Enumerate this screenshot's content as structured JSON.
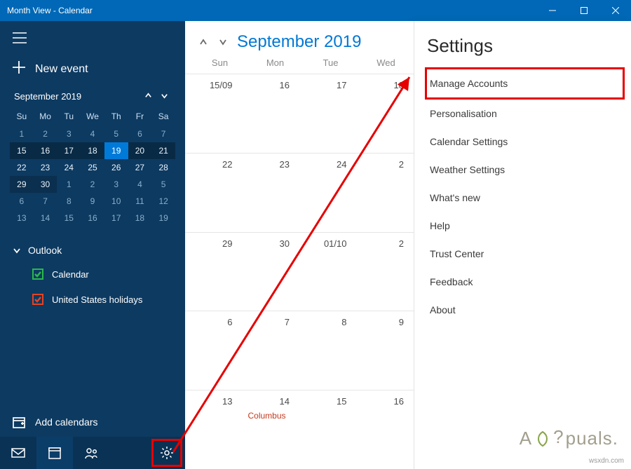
{
  "window": {
    "title": "Month View - Calendar"
  },
  "sidebar": {
    "new_event": "New event",
    "mini_calendar": {
      "title": "September 2019",
      "dows": [
        "Su",
        "Mo",
        "Tu",
        "We",
        "Th",
        "Fr",
        "Sa"
      ],
      "rows": [
        [
          {
            "n": "1",
            "cls": "out"
          },
          {
            "n": "2",
            "cls": "out"
          },
          {
            "n": "3",
            "cls": "out"
          },
          {
            "n": "4",
            "cls": "out"
          },
          {
            "n": "5",
            "cls": "out"
          },
          {
            "n": "6",
            "cls": "out"
          },
          {
            "n": "7",
            "cls": "out"
          }
        ],
        [
          {
            "n": "15",
            "cls": "current-week"
          },
          {
            "n": "16",
            "cls": "current-week"
          },
          {
            "n": "17",
            "cls": "current-week"
          },
          {
            "n": "18",
            "cls": "current-week"
          },
          {
            "n": "19",
            "cls": "today"
          },
          {
            "n": "20",
            "cls": "current-week"
          },
          {
            "n": "21",
            "cls": "current-week"
          }
        ],
        [
          {
            "n": "22",
            "cls": ""
          },
          {
            "n": "23",
            "cls": ""
          },
          {
            "n": "24",
            "cls": ""
          },
          {
            "n": "25",
            "cls": ""
          },
          {
            "n": "26",
            "cls": ""
          },
          {
            "n": "27",
            "cls": ""
          },
          {
            "n": "28",
            "cls": ""
          }
        ],
        [
          {
            "n": "29",
            "cls": "prev-cur"
          },
          {
            "n": "30",
            "cls": "prev-cur"
          },
          {
            "n": "1",
            "cls": "out"
          },
          {
            "n": "2",
            "cls": "out"
          },
          {
            "n": "3",
            "cls": "out"
          },
          {
            "n": "4",
            "cls": "out"
          },
          {
            "n": "5",
            "cls": "out"
          }
        ],
        [
          {
            "n": "6",
            "cls": "out"
          },
          {
            "n": "7",
            "cls": "out"
          },
          {
            "n": "8",
            "cls": "out"
          },
          {
            "n": "9",
            "cls": "out"
          },
          {
            "n": "10",
            "cls": "out"
          },
          {
            "n": "11",
            "cls": "out"
          },
          {
            "n": "12",
            "cls": "out"
          }
        ],
        [
          {
            "n": "13",
            "cls": "out"
          },
          {
            "n": "14",
            "cls": "out"
          },
          {
            "n": "15",
            "cls": "out"
          },
          {
            "n": "16",
            "cls": "out"
          },
          {
            "n": "17",
            "cls": "out"
          },
          {
            "n": "18",
            "cls": "out"
          },
          {
            "n": "19",
            "cls": "out"
          }
        ]
      ]
    },
    "accounts": [
      {
        "name": "Outlook",
        "calendars": [
          {
            "label": "Calendar",
            "color": "green"
          },
          {
            "label": "United States holidays",
            "color": "red"
          }
        ]
      }
    ],
    "add_calendars": "Add calendars"
  },
  "calendar": {
    "title": "September 2019",
    "dows": [
      "Sun",
      "Mon",
      "Tue",
      "Wed"
    ],
    "weeks": [
      [
        {
          "label": "15/09"
        },
        {
          "label": "16"
        },
        {
          "label": "17"
        },
        {
          "label": "18"
        }
      ],
      [
        {
          "label": "22"
        },
        {
          "label": "23"
        },
        {
          "label": "24"
        },
        {
          "label": "2"
        }
      ],
      [
        {
          "label": "29"
        },
        {
          "label": "30"
        },
        {
          "label": "01/10"
        },
        {
          "label": "2"
        }
      ],
      [
        {
          "label": "6"
        },
        {
          "label": "7"
        },
        {
          "label": "8"
        },
        {
          "label": "9"
        }
      ],
      [
        {
          "label": "13"
        },
        {
          "label": "14",
          "event": "Columbus"
        },
        {
          "label": "15"
        },
        {
          "label": "16"
        }
      ]
    ]
  },
  "settings": {
    "title": "Settings",
    "items": [
      "Manage Accounts",
      "Personalisation",
      "Calendar Settings",
      "Weather Settings",
      "What's new",
      "Help",
      "Trust Center",
      "Feedback",
      "About"
    ]
  },
  "watermarks": {
    "brand": "A  puals.",
    "site": "wsxdn.com"
  }
}
